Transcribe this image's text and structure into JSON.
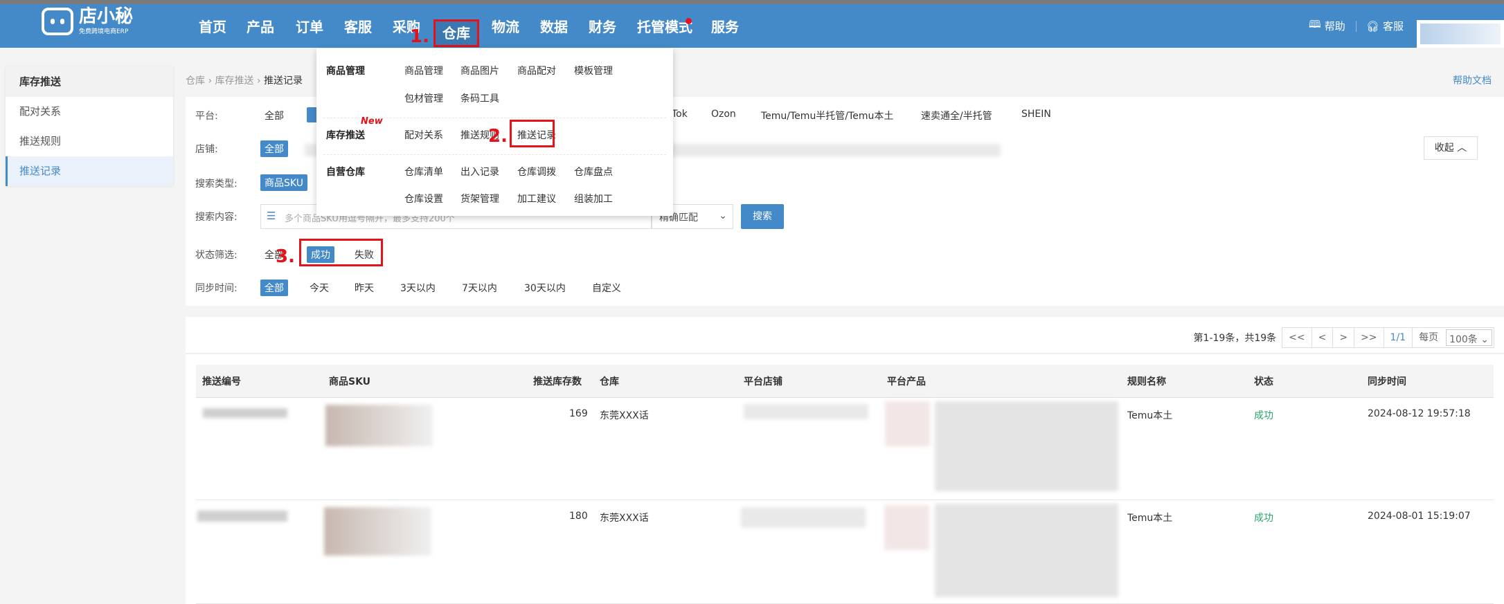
{
  "header": {
    "logo_title": "店小秘",
    "logo_subtitle": "免费跨境电商ERP",
    "nav": [
      "首页",
      "产品",
      "订单",
      "客服",
      "采购",
      "仓库",
      "物流",
      "数据",
      "财务",
      "托管模式",
      "服务"
    ],
    "help": "帮助",
    "service": "客服"
  },
  "sidebar": {
    "title": "库存推送",
    "items": [
      "配对关系",
      "推送规则",
      "推送记录"
    ]
  },
  "breadcrumb": [
    "仓库",
    "库存推送",
    "推送记录"
  ],
  "help_doc": "帮助文档",
  "menu": {
    "sections": [
      {
        "title": "商品管理",
        "items": [
          "商品管理",
          "商品图片",
          "商品配对",
          "模板管理",
          "包材管理",
          "条码工具"
        ]
      },
      {
        "title": "库存推送",
        "badge": "New",
        "items": [
          "配对关系",
          "推送规则",
          "推送记录"
        ]
      },
      {
        "title": "自营仓库",
        "items": [
          "仓库清单",
          "出入记录",
          "仓库调拨",
          "仓库盘点",
          "仓库设置",
          "货架管理",
          "加工建议",
          "组装加工"
        ]
      }
    ]
  },
  "filters": {
    "platform_label": "平台:",
    "platform_options": [
      "全部",
      "Tok",
      "Ozon",
      "Temu/Temu半托管/Temu本土",
      "速卖通全/半托管",
      "SHEIN"
    ],
    "shop_label": "店铺:",
    "shop_selected": "全部",
    "search_type_label": "搜索类型:",
    "search_type_selected": "商品SKU",
    "search_content_label": "搜索内容:",
    "search_placeholder": "多个商品SKU用逗号隔开，最多支持200个",
    "match_mode": "精确匹配",
    "search_button": "搜索",
    "status_label": "状态筛选:",
    "status_options": [
      "全部",
      "成功",
      "失败"
    ],
    "status_selected": "成功",
    "time_label": "同步时间:",
    "time_options": [
      "全部",
      "今天",
      "昨天",
      "3天以内",
      "7天以内",
      "30天以内",
      "自定义"
    ],
    "collapse": "收起 ︿"
  },
  "annotations": [
    "1.",
    "2.",
    "3."
  ],
  "pager": {
    "summary": "第1-19条，共19条",
    "first": "<<",
    "prev": "<",
    "next": ">",
    "last": ">>",
    "page": "1/1",
    "per_page_label": "每页",
    "per_page": "100条"
  },
  "table": {
    "columns": [
      "推送编号",
      "商品SKU",
      "推送库存数",
      "仓库",
      "平台店铺",
      "平台产品",
      "规则名称",
      "状态",
      "同步时间"
    ],
    "rows": [
      {
        "qty": "169",
        "warehouse": "东莞XXX话",
        "rule": "Temu本土",
        "status": "成功",
        "time": "2024-08-12 19:57:18"
      },
      {
        "qty": "180",
        "warehouse": "东莞XXX话",
        "rule": "Temu本土",
        "status": "成功",
        "time": "2024-08-01 15:19:07"
      }
    ]
  },
  "colors": {
    "brand": "#448ac9",
    "annotation": "#e3121b",
    "success": "#2aa56a"
  }
}
